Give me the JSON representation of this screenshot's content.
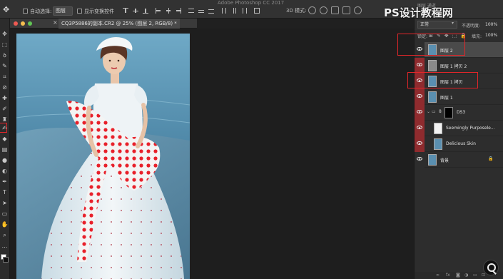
{
  "app": {
    "title": "Adobe Photoshop CC 2017"
  },
  "watermark": {
    "top": "PS设计教程网",
    "topright_tabs": "图层  通道"
  },
  "options_bar": {
    "auto_select_label": "自动选择:",
    "auto_select_value": "图层",
    "show_transform_label": "显示变换控件",
    "mode_3d_label": "3D 模式:"
  },
  "document": {
    "tab_title": "CQ3P5886的副本.CR2 @ 25% (图层 2, RGB/8) *",
    "close_glyph": "×"
  },
  "layers_panel": {
    "blend_mode": "正常",
    "opacity_label": "不透明度:",
    "opacity_value": "100%",
    "lock_label": "锁定:",
    "fill_label": "填充:",
    "fill_value": "100%",
    "layers": [
      {
        "name": "图层 2",
        "visible": true,
        "selected": true,
        "highlighted": true,
        "thumb": "photo"
      },
      {
        "name": "图层 1 拷贝 2",
        "visible": true,
        "selected": false,
        "highlighted": false,
        "thumb": "gray"
      },
      {
        "name": "图层 1 拷贝",
        "visible": true,
        "selected": false,
        "highlighted": true,
        "thumb": "photo"
      },
      {
        "name": "图层 1",
        "visible": true,
        "selected": false,
        "highlighted": false,
        "thumb": "photo"
      },
      {
        "name": "DS3",
        "visible": true,
        "selected": false,
        "highlighted": false,
        "thumb": "group"
      },
      {
        "name": "Seemingly Purposele...",
        "visible": true,
        "selected": false,
        "highlighted": false,
        "thumb": "white"
      },
      {
        "name": "Delicious Skin",
        "visible": true,
        "selected": false,
        "highlighted": false,
        "thumb": "photo"
      },
      {
        "name": "背景",
        "visible": true,
        "selected": false,
        "highlighted": false,
        "thumb": "photo"
      }
    ],
    "bottom_icons": [
      "link-icon",
      "fx-icon",
      "mask-icon",
      "adjustment-icon",
      "folder-icon",
      "new-layer-icon",
      "trash-icon"
    ]
  },
  "colors": {
    "accent_red": "#e2262a",
    "eye_column_red": "#8f2b2e",
    "panel_bg": "#2d2d2d",
    "canvas_bg": "#1e1e1e"
  }
}
